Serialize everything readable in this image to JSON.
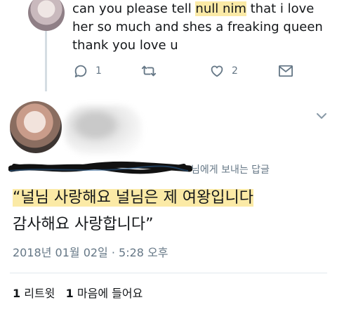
{
  "reply": {
    "text_before": "can you please tell ",
    "text_highlight": "null nim",
    "text_after": " that i love her so much and shes a freaking queen thank you love u",
    "reply_count": "1",
    "like_count": "2"
  },
  "tweet": {
    "replying_to_label": "님에게 보내는 답글",
    "body_highlight": "“널님 사랑해요 널님은 제 여왕입니다",
    "body_rest": "감사해요 사랑합니다”",
    "timestamp": "2018년 01월 02일 · 5:28 오후",
    "retweet_count": "1",
    "retweet_label": "리트윗",
    "like_count": "1",
    "like_label": "마음에 들어요"
  },
  "colors": {
    "highlight": "#fbeaa6",
    "meta_text": "#657786",
    "icon": "#657786",
    "divider": "#e1e8ed"
  },
  "icons": [
    "reply-icon",
    "retweet-icon",
    "heart-icon",
    "message-icon",
    "chevron-down-icon"
  ]
}
